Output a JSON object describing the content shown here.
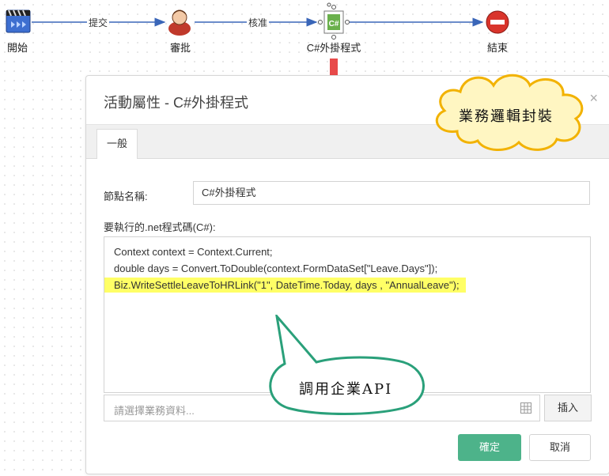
{
  "flow": {
    "nodes": [
      {
        "label": "開始",
        "icon": "film-clapper-icon"
      },
      {
        "label": "審批",
        "icon": "user-icon"
      },
      {
        "label": "C#外掛程式",
        "icon": "csharp-plugin-icon"
      },
      {
        "label": "結束",
        "icon": "stop-icon"
      }
    ],
    "edges": [
      {
        "label": "提交"
      },
      {
        "label": "核准"
      }
    ]
  },
  "dialog": {
    "title": "活動屬性 - C#外掛程式",
    "close": "×",
    "tabs": [
      {
        "label": "一般",
        "active": true
      }
    ],
    "node_name_label": "節點名稱:",
    "node_name_value": "C#外掛程式",
    "code_label": "要執行的.net程式碼(C#):",
    "code_lines": [
      "Context context = Context.Current;",
      "double days = Convert.ToDouble(context.FormDataSet[\"Leave.Days\"]);",
      "Biz.WriteSettleLeaveToHRLink(\"1\", DateTime.Today, days , \"AnnualLeave\");"
    ],
    "highlight_line_index": 2,
    "business_data_placeholder": "請選擇業務資料...",
    "insert_button": "插入",
    "ok_button": "確定",
    "cancel_button": "取消"
  },
  "callouts": {
    "cloud": "業務邏輯封裝",
    "speech": "調用企業API"
  },
  "colors": {
    "accent_green": "#4db38a",
    "highlight_yellow": "#ffff66",
    "arrow_red": "#e84a4a",
    "callout_border_teal": "#2aa07a",
    "cloud_fill": "#fff6c2",
    "cloud_border": "#f2b200"
  }
}
